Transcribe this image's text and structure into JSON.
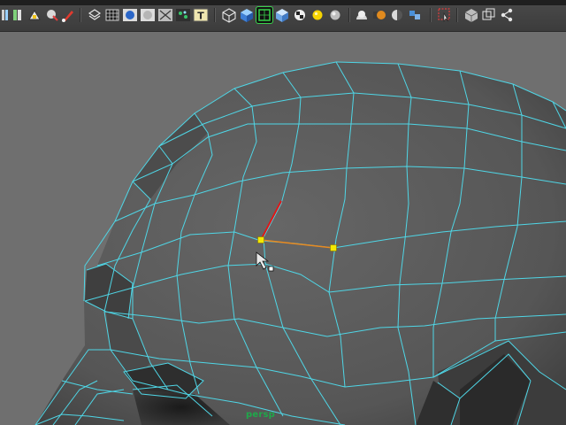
{
  "toolbar": {
    "icons": [
      "menu-set-icon",
      "snap-to-grid-icon",
      "snap-to-curve-icon",
      "sculpt-tool-icon",
      "paint-tool-icon",
      "wireframe-icon",
      "grid-display-icon",
      "smooth-shade-icon",
      "flat-shade-icon",
      "x-ray-icon",
      "uv-texture-icon",
      "text-tool-icon",
      "cube-wire-icon",
      "cube-shaded-icon",
      "cube-selected-icon",
      "cube-textured-icon",
      "checker-icon",
      "light-bulb-icon",
      "sphere-icon",
      "render-sphere-icon",
      "render-icon",
      "ipr-render-icon",
      "render-settings-icon",
      "select-tool-icon",
      "panel-single-icon",
      "panel-layout-icon",
      "share-icon"
    ],
    "colors": {
      "bar": "#444444",
      "accent_yellow": "#f6d400",
      "accent_blue": "#4a90d9",
      "accent_red": "#d63a2a",
      "accent_green": "#34b24a"
    }
  },
  "viewport": {
    "camera_name": "persp",
    "colors": {
      "background": "#6f6f6f",
      "wire": "#4fd6e6",
      "mesh_fill": "#5a5a5a",
      "selected_vertex": "#f4e800",
      "edge_red": "#e01818",
      "edge_orange": "#e88a20"
    }
  }
}
